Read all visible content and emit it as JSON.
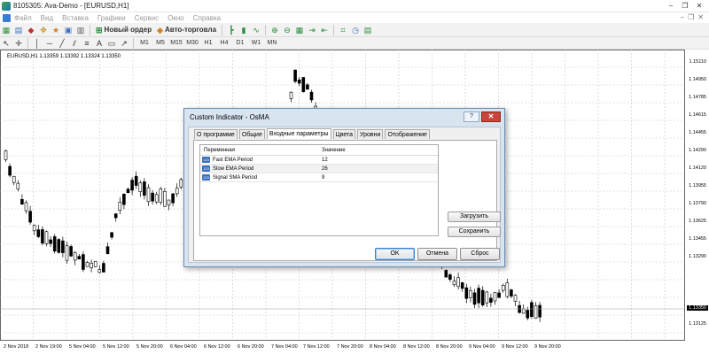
{
  "window": {
    "title": "8105305: Ava-Demo - [EURUSD,H1]",
    "controls": [
      "–",
      "❐",
      "✕"
    ],
    "inner_controls": [
      "–",
      "❐",
      "✕"
    ]
  },
  "menu": [
    "Файл",
    "Вид",
    "Вставка",
    "Графики",
    "Сервис",
    "Окно",
    "Справка"
  ],
  "toolbar": {
    "new_order": "Новый ордер",
    "autotrading": "Авто-торговла",
    "timeframes": [
      "M1",
      "M5",
      "M15",
      "M30",
      "H1",
      "H4",
      "D1",
      "W1",
      "MN"
    ]
  },
  "chart": {
    "symbol_info": "EURUSD,H1  1.13359 1.13392 1.13324 1.13350",
    "price_labels": [
      "1.15110",
      "1.14950",
      "1.14785",
      "1.14615",
      "1.14455",
      "1.14290",
      "1.14120",
      "1.13955",
      "1.13790",
      "1.13625",
      "1.13455",
      "1.13290",
      "1.13125"
    ],
    "current_price": "1.13350",
    "time_labels": [
      "2 Nov 2018",
      "2 Nov 19:00",
      "5 Nov 04:00",
      "5 Nov 12:00",
      "5 Nov 20:00",
      "6 Nov 04:00",
      "6 Nov 12:00",
      "6 Nov 20:00",
      "7 Nov 04:00",
      "7 Nov 12:00",
      "7 Nov 20:00",
      "8 Nov 04:00",
      "8 Nov 12:00",
      "8 Nov 20:00",
      "9 Nov 04:00",
      "9 Nov 12:00",
      "9 Nov 20:00"
    ]
  },
  "dialog": {
    "title": "Custom Indicator - OsMA",
    "help": "?",
    "close": "✕",
    "tabs": [
      "О программе",
      "Общие",
      "Входные параметры",
      "Цвета",
      "Уровни",
      "Отображение"
    ],
    "active_tab": "Входные параметры",
    "columns": [
      "Переменная",
      "Значение"
    ],
    "params": [
      {
        "icon": "123",
        "name": "Fast EMA Period",
        "value": "12"
      },
      {
        "icon": "123",
        "name": "Slow EMA Period",
        "value": "26"
      },
      {
        "icon": "123",
        "name": "Signal SMA Period",
        "value": "9"
      }
    ],
    "load_button": "Загрузить",
    "save_button": "Сохранить",
    "ok_button": "OK",
    "cancel_button": "Отмена",
    "reset_button": "Сброс"
  },
  "colors": {
    "candle_bull": "#ffffff",
    "candle_bear": "#000000",
    "grid": "#c8c8c8",
    "dialog_bg": "#d9e4f1"
  }
}
